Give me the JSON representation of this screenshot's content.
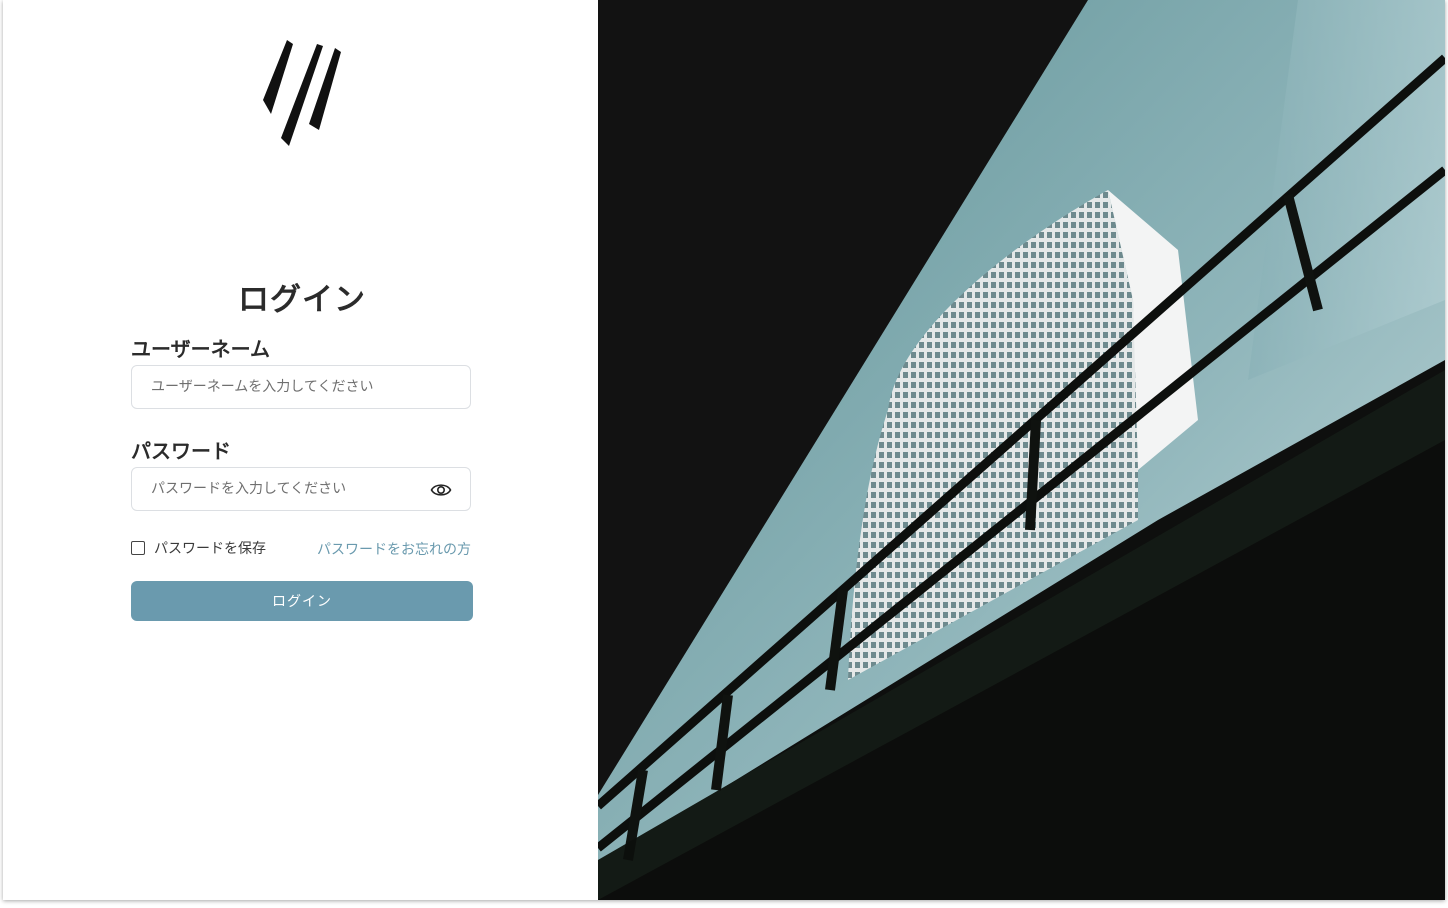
{
  "brand": {
    "logo_icon": "slash-stripes-logo-icon"
  },
  "login": {
    "title": "ログイン",
    "username_label": "ユーザーネーム",
    "username_placeholder": "ユーザーネームを入力してください",
    "username_value": "",
    "password_label": "パスワード",
    "password_placeholder": "パスワードを入力してください",
    "password_value": "",
    "password_visibility_icon": "eye-icon",
    "remember_label": "パスワードを保存",
    "remember_checked": false,
    "forgot_link": "パスワードをお忘れの方",
    "submit_label": "ログイン"
  },
  "hero": {
    "image": "building-under-bridge-photo"
  },
  "colors": {
    "accent": "#6a9aae",
    "text": "#2b2b2b",
    "hero_dark": "#121212",
    "hero_sky": "#8fb5ba"
  }
}
